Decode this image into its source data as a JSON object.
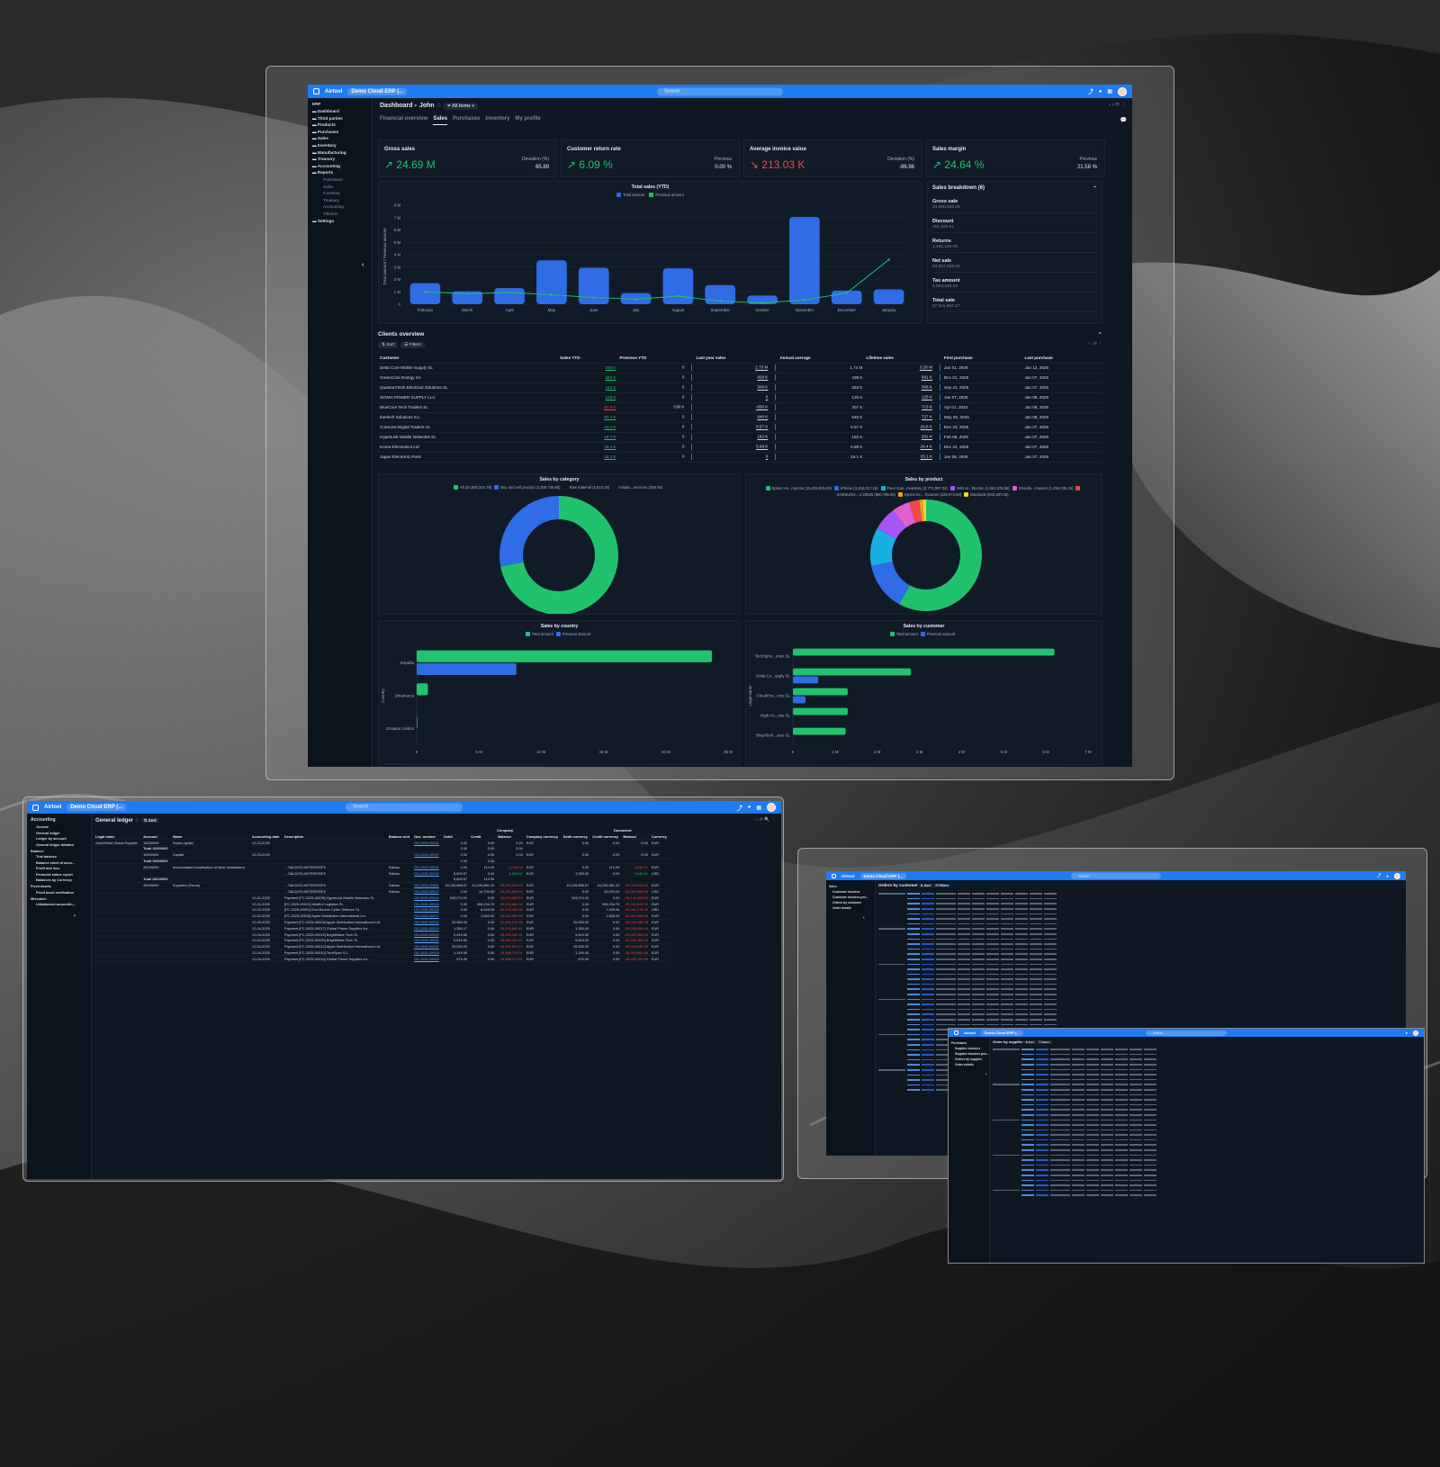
{
  "app": {
    "brand": "Airtool",
    "project": "Demo Cloud ERP (...",
    "search_placeholder": "Search",
    "colors": {
      "accent": "#1f7bf2",
      "green": "#21c26e",
      "blue": "#2f6ce6",
      "red": "#f04848"
    }
  },
  "dashboard": {
    "sidebar": {
      "root": "ERP",
      "items": [
        "Dashboard",
        "Third parties",
        "Products",
        "Purchases",
        "Sales",
        "Inventory",
        "Manufacturing",
        "Treasury",
        "Accounting",
        "Reports"
      ],
      "report_items": [
        "Purchases",
        "Sales",
        "Inventory",
        "Treasury",
        "Accounting",
        "Tributes"
      ],
      "settings": "Settings",
      "collapse_icon": "chevron-left-icon"
    },
    "breadcrumb": {
      "root": "Dashboard",
      "sep": "▸",
      "current": "John",
      "filter": "All items"
    },
    "tabs": [
      "Financial overview",
      "Sales",
      "Purchases",
      "Inventory",
      "My profile"
    ],
    "active_tab": "Sales",
    "kpis": [
      {
        "label": "Gross sales",
        "value": "↗ 24.69 M",
        "dev_label": "Deviation (%)",
        "dev_value": "65.89",
        "color": "green"
      },
      {
        "label": "Customer return rate",
        "value": "↗ 6.09 %",
        "dev_label": "Previous",
        "dev_value": "0.00 %",
        "color": "green"
      },
      {
        "label": "Average invoice value",
        "value": "↘ 213.03 K",
        "dev_label": "Deviation (%)",
        "dev_value": "-96.96",
        "color": "red"
      },
      {
        "label": "Sales margin",
        "value": "↗ 24.64 %",
        "dev_label": "Previous",
        "dev_value": "21.58 %",
        "color": "green"
      }
    ],
    "breakdown": {
      "title": "Sales breakdown (6)",
      "items": [
        {
          "label": "Gross sale",
          "value": "24,690,555.09"
        },
        {
          "label": "Discount",
          "value": "151,826.51"
        },
        {
          "label": "Returns",
          "value": "1,481,100.00"
        },
        {
          "label": "Net sale",
          "value": "23,057,628.63"
        },
        {
          "label": "Tax amount",
          "value": "4,553,436.18"
        },
        {
          "label": "Total sale",
          "value": "27,611,064.17"
        }
      ]
    },
    "clients": {
      "title": "Clients overview",
      "sort": "Sort",
      "filters": "Filters",
      "columns": [
        "Customer",
        "Sales YTD",
        "Previous YTD",
        "Last year sales",
        "Annual average",
        "Lifetime sales",
        "First purchase",
        "Last purchase"
      ],
      "rows": [
        [
          "Delta Core Mobile Supply SL",
          "295 K",
          "0",
          "2.73 M",
          "1.74 M",
          "3.28 M",
          "Jan 01, 2026",
          "Jan 12, 2026",
          "g"
        ],
        [
          "GreenCore Energy SA",
          "262 K",
          "0",
          "428 K",
          "438 K",
          "681 K",
          "Dec 01, 2025",
          "Jan 07, 2026",
          "g"
        ],
        [
          "QuantumTech Electrical Solutions SL",
          "140 K",
          "0",
          "308 K",
          "363 K",
          "308 K",
          "Sep 24, 2025",
          "Jan 07, 2026",
          "g"
        ],
        [
          "SIGMA POWER SUPPLY LLC",
          "125 K",
          "0",
          "0",
          "125 K",
          "125 K",
          "Jan 07, 2026",
          "Jan 08, 2026",
          "g"
        ],
        [
          "BlueCore Tech Traders SL",
          "87.6 K",
          "538 K",
          "-658 K",
          "307 K",
          "713 K",
          "Apr 01, 2024",
          "Jan 08, 2026",
          "r"
        ],
        [
          "Iberlech Solutions S.L.",
          "57.1 K",
          "0",
          "640 K",
          "640 K",
          "727 K",
          "May 06, 2025",
          "Jan 08, 2026",
          "g"
        ],
        [
          "CoreLine Digital Traders SL",
          "24.2 K",
          "0",
          "5.57 K",
          "5.57 K",
          "29.8 K",
          "Dec 23, 2025",
          "Jan 07, 2026",
          "g"
        ],
        [
          "HyperLink Mobile Networks SL",
          "18.7 K",
          "0",
          "182 K",
          "182 K",
          "201 K",
          "Feb 08, 2025",
          "Jan 07, 2026",
          "g"
        ],
        [
          "Korea Electronics Ltd",
          "18.4 K",
          "0",
          "5.99 K",
          "5.99 K",
          "24.4 K",
          "Dec 24, 2025",
          "Jan 07, 2026",
          "g"
        ],
        [
          "Japan Electronic Parts",
          "15.1 K",
          "0",
          "0",
          "15.1 K",
          "15.1 K",
          "Jan 08, 2026",
          "Jan 07, 2026",
          "g"
        ]
      ]
    },
    "sales_by_category": {
      "title": "Sales by category",
      "legend": [
        "All (20,500,254.78)",
        "Buy and sell product (3,305,745.60)",
        "Raw material (5,810.19)",
        "Installa...services (258.05)"
      ],
      "values": [
        72,
        28
      ],
      "colors": [
        "#21c26e",
        "#2f6ce6"
      ]
    },
    "sales_by_product": {
      "title": "Sales by product",
      "legend": [
        "Epson Ho...rojector (15,039,935.00)",
        "iPhone (3,252,017.15)",
        "Fleur Gas...inventory (2,771,957.34)",
        "WiFi Ki...Electric (1,551,578.55)",
        "Stroella...chasers (1,259,035.25)",
        "SAMSUNG....s 20025 (890,785.05)",
        "Epson Ec... Scanner (229,073.80)",
        "MacBook (502,287.05)"
      ],
      "values": [
        58,
        14,
        11,
        7,
        5,
        3,
        1,
        1
      ],
      "colors": [
        "#21c26e",
        "#2f6ce6",
        "#17b0e0",
        "#a855f7",
        "#e05fd0",
        "#f04848",
        "#f59a23",
        "#f2d22e"
      ]
    },
    "sales_by_country": {
      "title": "Sales by country",
      "legend": [
        "Total amount",
        "Previous amount"
      ],
      "ylabel": "Country",
      "categories": [
        "España",
        "Dinamarca",
        "Estados Unidos"
      ],
      "total": [
        23.7,
        0.9,
        0.05
      ],
      "previous": [
        8.0,
        0,
        0
      ],
      "ticks": [
        "0",
        "5 M",
        "10 M",
        "15 M",
        "20 M",
        "25 M"
      ],
      "max": 25
    },
    "sales_by_customer": {
      "title": "Sales by customer",
      "legend": [
        "Total amount",
        "Previous amount"
      ],
      "ylabel": "Legal name",
      "categories": [
        "TechSpho...ones SL",
        "Delta Co...upply SL",
        "CloudPos...ions SL",
        "High-Vo...ons SL",
        "ShopTech...ores SL"
      ],
      "total": [
        6.2,
        2.8,
        1.3,
        1.3,
        1.25
      ],
      "previous": [
        0,
        0.6,
        0.3,
        0,
        0
      ],
      "ticks": [
        "0",
        "1 M",
        "2 M",
        "3 M",
        "4 M",
        "5 M",
        "6 M",
        "7 M"
      ],
      "max": 7
    }
  },
  "chart_data": {
    "type": "bar",
    "title": "Total sales (YTD)",
    "legend": [
      "Total amount",
      "Previous amount"
    ],
    "ylabel": "Total amount / Previous amount",
    "categories": [
      "February",
      "March",
      "April",
      "May",
      "June",
      "July",
      "August",
      "September",
      "October",
      "November",
      "December",
      "January"
    ],
    "series": [
      {
        "name": "Total amount",
        "values": [
          1.7,
          1.05,
          1.3,
          3.55,
          2.95,
          0.9,
          2.9,
          1.55,
          0.7,
          7.05,
          1.1,
          1.2
        ]
      },
      {
        "name": "Previous amount",
        "values": [
          1.0,
          0.85,
          0.95,
          0.75,
          0.55,
          0.4,
          0.65,
          0.25,
          0.1,
          0.35,
          0.9,
          3.6
        ]
      }
    ],
    "ylim": [
      0,
      8
    ],
    "yticks": [
      "0",
      "1 M",
      "2 M",
      "3 M",
      "4 M",
      "5 M",
      "6 M",
      "7 M",
      "8 M"
    ]
  },
  "ledger": {
    "sidebar": {
      "section": "Accounting",
      "items": [
        "Journal",
        "General ledger",
        "Ledger by account",
        "General ledger detailed"
      ],
      "groups": [
        {
          "name": "Balance",
          "items": [
            "Trial balance",
            "Balance sheet of acco...",
            "Profit and loss",
            "Financial status report",
            "Balances by Currency"
          ]
        },
        {
          "name": "Fixed assets",
          "items": [
            "Fixed asset verification"
          ]
        },
        {
          "name": "Mismatch",
          "items": [
            "Unbalanced accountin..."
          ]
        }
      ]
    },
    "title": "General ledger",
    "sort": "Sort",
    "group_company": "Company",
    "group_document": "Document",
    "columns": [
      "Legal name",
      "Account",
      "Name",
      "Accounting date",
      "Description",
      "Balance unit",
      "Doc. number",
      "Debit",
      "Credit",
      "Balance",
      "Company currency",
      "Debit currency",
      "Credit currency",
      "Balance",
      "Currency"
    ],
    "rows": [
      [
        "GreenField Global Supplier",
        "10000000",
        "Share capital",
        "12-23-2025",
        "",
        "",
        "DS-2025-00001",
        "0.00",
        "0.00",
        "0.00",
        "EUR",
        "0.00",
        "0.00",
        "0.00",
        "EUR"
      ],
      [
        "",
        "Total 10000000",
        "",
        "",
        "",
        "",
        "",
        "0.00",
        "0.00",
        "0.00",
        "",
        "",
        "",
        "",
        ""
      ],
      [
        "",
        "10000000",
        "Capital",
        "12-23-2025",
        "",
        "",
        "DS-2025-00047",
        "0.00",
        "0.00",
        "0.00",
        "EUR",
        "0.00",
        "0.00",
        "0.00",
        "EUR"
      ],
      [
        "",
        "Total 10000000",
        "",
        "",
        "",
        "",
        "",
        "0.00",
        "0.00",
        "",
        "",
        "",
        "",
        "",
        ""
      ],
      [
        "",
        "28100000",
        "Accumulated amortisation of other installations",
        "",
        "... SALDOS ANTERIORES",
        "Saldos",
        "DS-2025-00001",
        "0.00",
        "114.99",
        "-4,794.09",
        "EUR",
        "0.00",
        "114.99",
        "-2,645.01",
        "EUR"
      ],
      [
        "",
        "",
        "",
        "",
        "... SALDOS ANTERIORES",
        "Saldos",
        "DS-2025-00002",
        "6,893.57",
        "0.00",
        "6,893.57",
        "EUR",
        "7,093.00",
        "0.00",
        "7,645.01",
        "USD"
      ],
      [
        "",
        "Total 28100000",
        "",
        "",
        "",
        "",
        "",
        "6,899.57",
        "114.99",
        "",
        "",
        "",
        "",
        "",
        ""
      ],
      [
        "",
        "40000000",
        "Suppliers (Euros)",
        "",
        "... SALDOS ANTERIORES",
        "Saldos",
        "DS-2025-00001",
        "15,195,856.67",
        "44,234,881.20",
        "-29,039,024.53",
        "EUR",
        "15,195,856.67",
        "44,234,881.20",
        "-29,039,024.53",
        "EUR"
      ],
      [
        "",
        "",
        "",
        "",
        "... SALDOS ANTERIORES",
        "Saldos",
        "DS-2025-00002",
        "0.00",
        "14,700.00",
        "-29,053,694.53",
        "EUR",
        "0.00",
        "40,020.00",
        "-29,060,658.63",
        "USD"
      ],
      [
        "",
        "",
        "",
        "12-01-2025",
        "Payment [FC-2025-00036] HyperLink Mobile Networks SL",
        "",
        "DS-2025-00014",
        "943,074.00",
        "0.00",
        "-28,110,650.53",
        "EUR",
        "943,074.00",
        "0.00",
        "-28,144,608.53",
        "EUR"
      ],
      [
        "",
        "",
        "",
        "12-01-2025",
        "[FC-2025-00021] MedKol Logistics SL",
        "",
        "DS-2025-00015",
        "0.00",
        "908,234.79",
        "-29,018,885.32",
        "EUR",
        "0.00",
        "908,234.79",
        "-29,052,843.32",
        "EUR"
      ],
      [
        "",
        "",
        "",
        "12-02-2025",
        "[FC-2026-00001] EuroSource Cyber Defence SL",
        "",
        "DS-2025-00016",
        "0.00",
        "6,445.26",
        "-29,025,330.58",
        "EUR",
        "0.00",
        "7,435.64",
        "-29,060,278.96",
        "USD"
      ],
      [
        "",
        "",
        "",
        "12-02-2025",
        "[FC-2025-00015] Apple Distribution International Ltd.",
        "",
        "DS-2025-00017",
        "0.00",
        "1,630.00",
        "-29,026,960.58",
        "EUR",
        "0.00",
        "1,630.00",
        "-29,061,908.96",
        "EUR"
      ],
      [
        "",
        "",
        "",
        "12-03-2025",
        "Payment [FC-2025-00004] Apple Distribution International Ltd.",
        "",
        "DS-2025-00018",
        "20,950.00",
        "0.00",
        "-29,006,010.58",
        "EUR",
        "20,950.00",
        "0.00",
        "-29,040,958.96",
        "EUR"
      ],
      [
        "",
        "",
        "",
        "12-04-2025",
        "Payment [FC-2025-00017] Global Phone Supplies Inc.",
        "",
        "DS-2025-00019",
        "1,350.17",
        "0.00",
        "-29,004,660.41",
        "EUR",
        "1,350.00",
        "0.00",
        "-29,039,608.96",
        "EUR"
      ],
      [
        "",
        "",
        "",
        "12-04-2025",
        "Payment [FC-2025-00019] BrightWave Tech SL",
        "",
        "DS-2025-00020",
        "9,619.50",
        "0.00",
        "-28,995,040.91",
        "EUR",
        "9,619.50",
        "0.00",
        "-29,029,989.46",
        "EUR"
      ],
      [
        "",
        "",
        "",
        "12-04-2025",
        "Payment [FC-2025-00020] BrightWave Tech SL",
        "",
        "DS-2025-00021",
        "9,619.50",
        "0.00",
        "-28,985,421.41",
        "EUR",
        "9,619.50",
        "0.00",
        "-29,020,369.96",
        "EUR"
      ],
      [
        "",
        "",
        "",
        "12-04-2025",
        "Payment [FC-2025-00012] Apple Distribution International Ltd.",
        "",
        "DS-2025-00022",
        "25,530.00",
        "0.00",
        "-28,959,891.41",
        "EUR",
        "25,530.00",
        "0.00",
        "-28,994,839.96",
        "EUR"
      ],
      [
        "",
        "",
        "",
        "12-04-2025",
        "Payment [FC-2025-00010] TechSpec S.L.",
        "",
        "DS-2025-00023",
        "1,149.50",
        "0.00",
        "-28,958,741.91",
        "EUR",
        "1,149.50",
        "0.00",
        "-28,993,690.46",
        "EUR"
      ],
      [
        "",
        "",
        "",
        "12-04-2025",
        "Payment [FC-2025-00014] Global Phone Supplies Inc.",
        "",
        "DS-2025-00024",
        "570.00",
        "0.00",
        "-28,958,171.91",
        "EUR",
        "570.00",
        "0.00",
        "-28,993,120.46",
        "EUR"
      ]
    ]
  },
  "orders_customer": {
    "sidebar": [
      "Sales",
      "Customer invoices",
      "Customer invoices pen...",
      "Orders by customer",
      "Order details"
    ],
    "title": "Orders by customer",
    "sort": "Sort",
    "filters": "Filters"
  },
  "orders_supplier": {
    "sidebar": [
      "Purchases",
      "Supplier invoices",
      "Supplier invoices pen...",
      "Orders by supplier",
      "Order details"
    ],
    "title": "Order by supplier",
    "sort": "Sort",
    "filters": "Filters"
  }
}
